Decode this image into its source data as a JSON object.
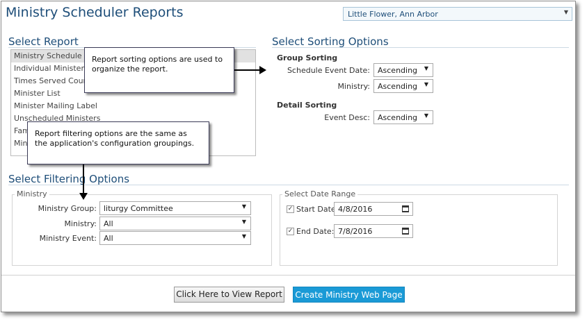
{
  "app_title": "Ministry Scheduler Reports",
  "location_select": {
    "value": "Little Flower, Ann Arbor"
  },
  "select_report": {
    "title": "Select Report",
    "items": [
      "Ministry Schedule",
      "Individual Minister Sche",
      "Times Served Count",
      "Minister List",
      "Minister Mailing Label",
      "Unscheduled Ministers",
      "Fam",
      "Mini"
    ],
    "selected_index": 0
  },
  "sorting": {
    "title": "Select Sorting Options",
    "group_heading": "Group Sorting",
    "schedule_event_date_label": "Schedule Event Date:",
    "schedule_event_date_value": "Ascending",
    "ministry_label": "Ministry:",
    "ministry_value": "Ascending",
    "detail_heading": "Detail Sorting",
    "event_desc_label": "Event Desc:",
    "event_desc_value": "Ascending"
  },
  "filtering": {
    "title": "Select Filtering Options",
    "ministry_legend": "Ministry",
    "ministry_group_label": "Ministry Group:",
    "ministry_group_value": "liturgy Committee",
    "ministry_label": "Ministry:",
    "ministry_value": "All",
    "ministry_event_label": "Ministry Event:",
    "ministry_event_value": "All",
    "date_legend": "Select Date Range",
    "start_date_label": "Start Date:",
    "start_date_value": "4/8/2016",
    "start_checked": true,
    "end_date_label": "End Date:",
    "end_date_value": "7/8/2016",
    "end_checked": true
  },
  "buttons": {
    "view_report": "Click Here to View Report",
    "create_web_page": "Create Ministry Web Page"
  },
  "callouts": {
    "sorting_note": "Report sorting options are used to organize the report.",
    "filtering_note": "Report filtering options are the same as the application's configuration groupings."
  },
  "colors": {
    "title_blue": "#1e4e79",
    "button_blue": "#1a9ad6"
  }
}
